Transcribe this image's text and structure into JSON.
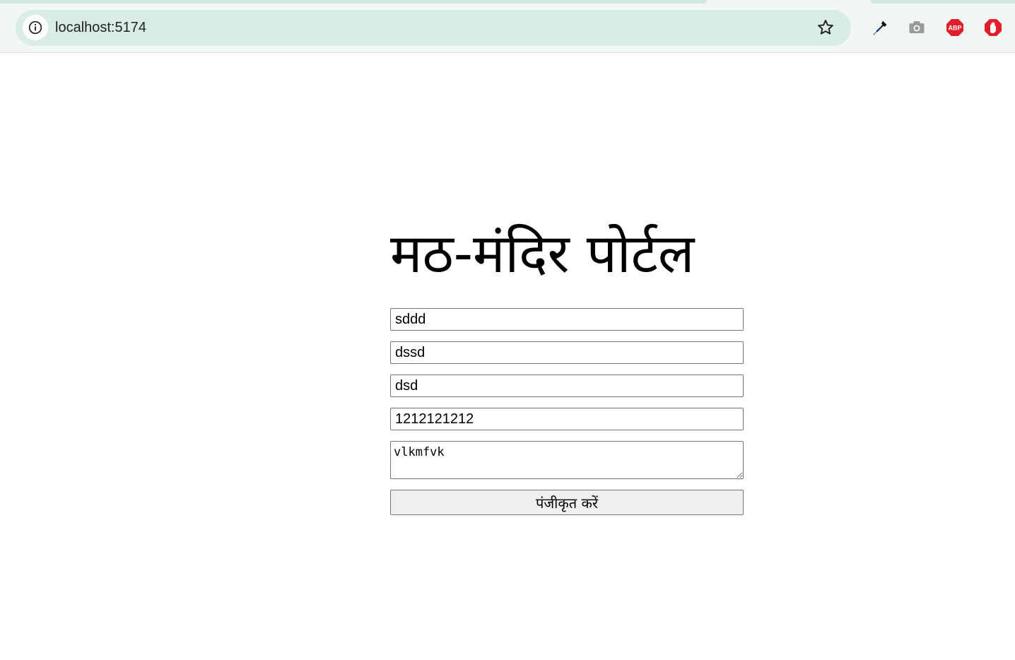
{
  "browser": {
    "url": "localhost:5174",
    "icons": {
      "site_info": "info-icon",
      "bookmark": "star-icon",
      "extensions": [
        "eyedropper-icon",
        "camera-icon",
        "adblock-plus-icon",
        "stop-hand-icon"
      ]
    },
    "colors": {
      "toolbar": "#f1f7f5",
      "omnibox": "#d9ece8",
      "abp_red": "#e41d2d"
    }
  },
  "page": {
    "title": "मठ-मंदिर पोर्टल",
    "form": {
      "fields": [
        {
          "value": "sddd"
        },
        {
          "value": "dssd"
        },
        {
          "value": "dsd"
        },
        {
          "value": "1212121212"
        }
      ],
      "textarea_value": "vlkmfvk",
      "submit_label": "पंजीकृत करें"
    }
  }
}
